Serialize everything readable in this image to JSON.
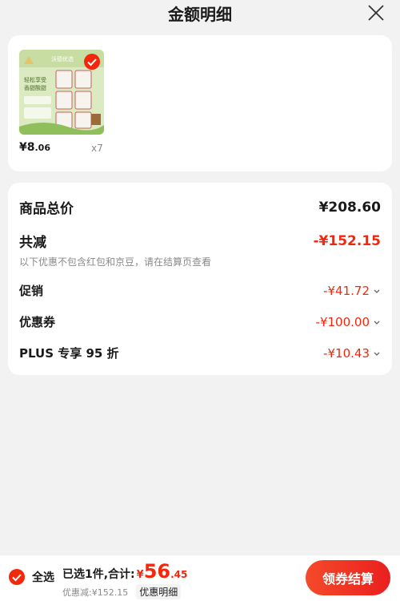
{
  "header": {
    "title": "金额明细"
  },
  "product": {
    "price_yen": "¥",
    "price_int": "8",
    "price_dec": ".06",
    "quantity": "x7",
    "thumb_banner": "沃德优选",
    "thumb_line1": "轻松享受",
    "thumb_line2": "香甜酸甜"
  },
  "summary": {
    "total_label": "商品总价",
    "total_value": "¥208.60",
    "reduce_label": "共减",
    "reduce_value": "-¥152.15",
    "note": "以下优惠不包含红包和京豆，请在结算页查看",
    "promo_label": "促销",
    "promo_value": "-¥41.72",
    "coupon_label": "优惠券",
    "coupon_value": "-¥100.00",
    "plus_label": "PLUS 专享 95 折",
    "plus_value": "-¥10.43"
  },
  "bottom": {
    "select_all": "全选",
    "selected_text": "已选1件,合计:",
    "total_yen": "¥",
    "total_int": "56",
    "total_dec": ".45",
    "discount": "优惠减:¥152.15",
    "detail_link": "优惠明细",
    "checkout": "领券结算"
  },
  "colors": {
    "accent": "#f2270c",
    "background": "#f2f2f2"
  }
}
